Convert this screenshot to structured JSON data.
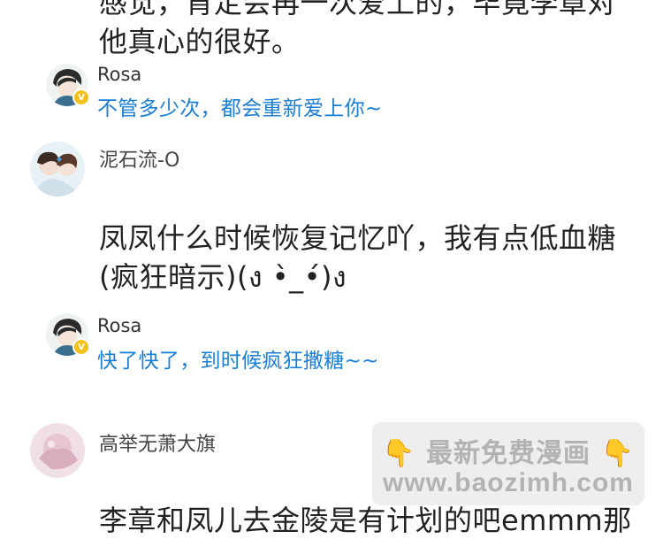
{
  "top_comment": {
    "line1_cut": "感觉，肯定会再一次爱上的，毕竟李章对",
    "line2": "他真心的很好。"
  },
  "reply1": {
    "username": "Rosa",
    "badge": "V",
    "text": "不管多少次，都会重新爱上你~"
  },
  "comment2": {
    "username": "泥石流-O",
    "line1": "凤凤什么时候恢复记忆吖，我有点低血糖",
    "line2": "(疯狂暗示)(ง •̀_•́)ง"
  },
  "reply2": {
    "username": "Rosa",
    "badge": "V",
    "text": "快了快了，到时候疯狂撒糖~~"
  },
  "comment3": {
    "username": "高举无萧大旗",
    "line1_cut": "李章和凤儿去金陵是有计划的吧emmm那"
  },
  "watermark": {
    "title": "最新免费漫画",
    "url": "www.baozimh.com",
    "left_icon": "pointing-hand-icon",
    "right_icon": "pointing-hand-icon"
  }
}
